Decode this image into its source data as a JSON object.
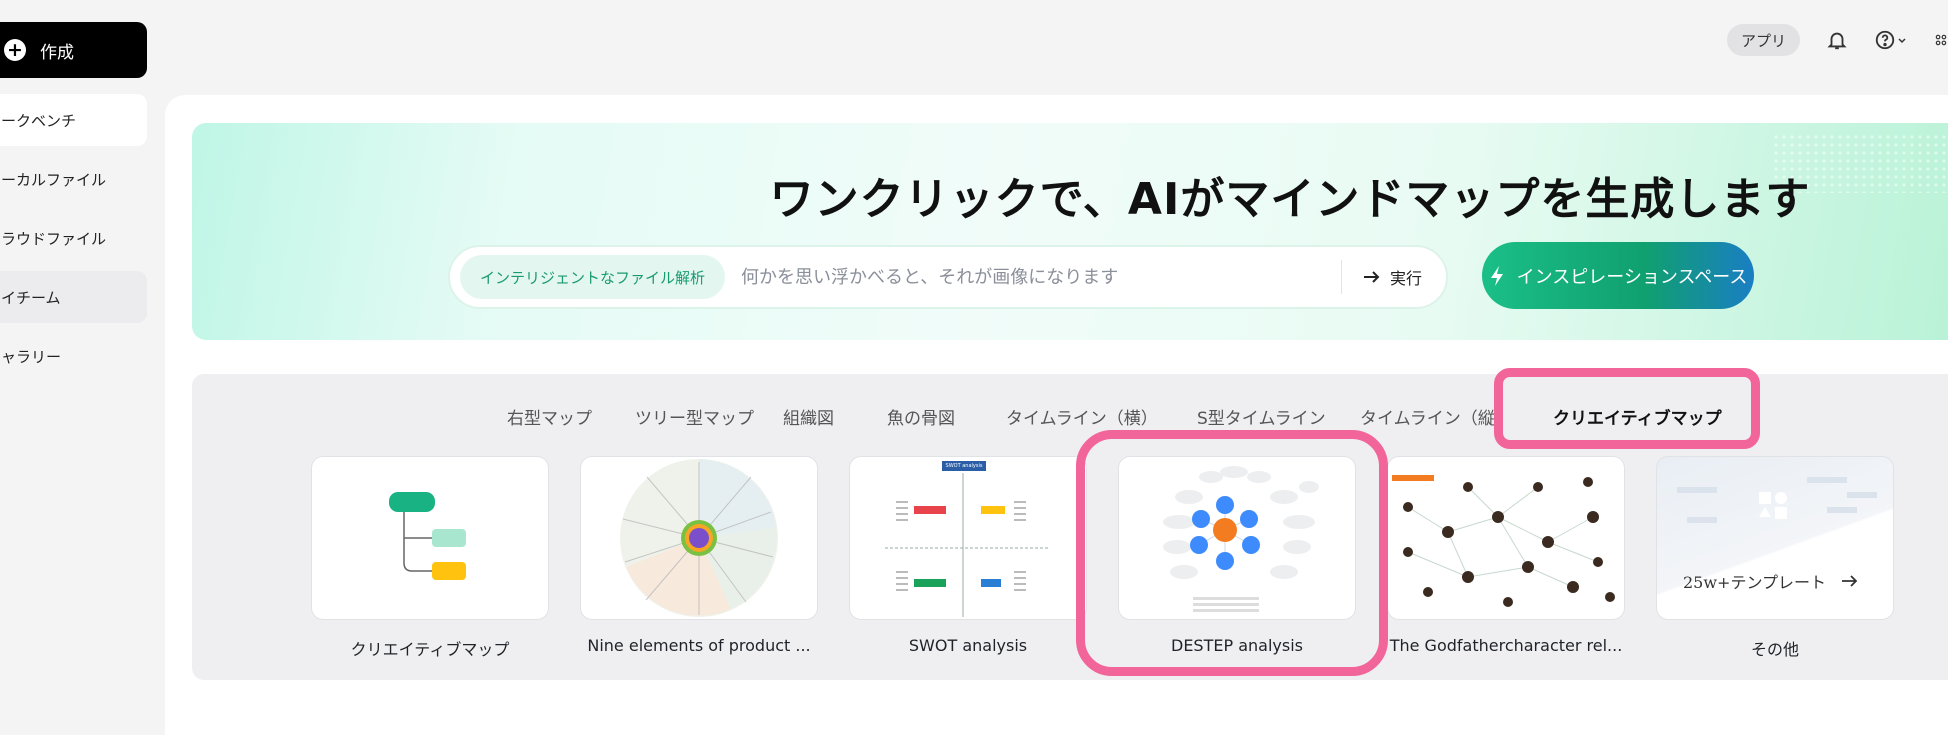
{
  "header": {
    "create_label": "作成",
    "app_label": "アプリ"
  },
  "sidebar": {
    "items": [
      {
        "label": "ワークベンチ"
      },
      {
        "label": "ローカルファイル"
      },
      {
        "label": "クラウドファイル"
      },
      {
        "label": "マイチーム"
      },
      {
        "label": "ギャラリー"
      }
    ]
  },
  "hero": {
    "title": "ワンクリックで、AIがマインドマップを生成します",
    "chip_label": "インテリジェントなファイル解析",
    "search_placeholder": "何かを思い浮かべると、それが画像になります",
    "execute_label": "実行",
    "inspiration_label": "インスピレーションスペース"
  },
  "templates": {
    "tabs": [
      {
        "label": "右型マップ"
      },
      {
        "label": "ツリー型マップ"
      },
      {
        "label": "組織図"
      },
      {
        "label": "魚の骨図"
      },
      {
        "label": "タイムライン（横）"
      },
      {
        "label": "S型タイムライン"
      },
      {
        "label": "タイムライン（縦）"
      },
      {
        "label": "クリエイティブマップ",
        "active": true
      }
    ],
    "cards": [
      {
        "label": "クリエイティブマップ"
      },
      {
        "label": "Nine elements of product ..."
      },
      {
        "label": "SWOT analysis"
      },
      {
        "label": "DESTEP analysis"
      },
      {
        "label": "The Godfathercharacter rel..."
      },
      {
        "label": "その他"
      }
    ],
    "swot_header": "SWOT analysis",
    "more_card_text": "25w+テンプレート"
  },
  "colors": {
    "highlight": "#f2659a",
    "accent_green": "#19b383"
  }
}
